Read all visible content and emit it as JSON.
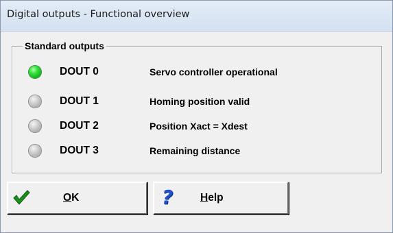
{
  "window": {
    "title": "Digital outputs - Functional overview"
  },
  "group": {
    "label": "Standard outputs"
  },
  "outputs": [
    {
      "name": "DOUT 0",
      "description": "Servo controller operational",
      "state": "on",
      "led_color": "#22cc2a"
    },
    {
      "name": "DOUT 1",
      "description": "Homing position valid",
      "state": "off",
      "led_color": "#b4b4b4"
    },
    {
      "name": "DOUT 2",
      "description": "Position Xact = Xdest",
      "state": "off",
      "led_color": "#b4b4b4"
    },
    {
      "name": "DOUT 3",
      "description": "Remaining distance",
      "state": "off",
      "led_color": "#b4b4b4"
    }
  ],
  "buttons": {
    "ok": {
      "accel": "O",
      "rest": "K",
      "icon": "checkmark-icon",
      "icon_color": "#1c8f1c"
    },
    "help": {
      "accel": "H",
      "rest": "elp",
      "icon": "question-mark-icon",
      "icon_glyph": "?",
      "icon_color": "#1f52c9"
    }
  }
}
